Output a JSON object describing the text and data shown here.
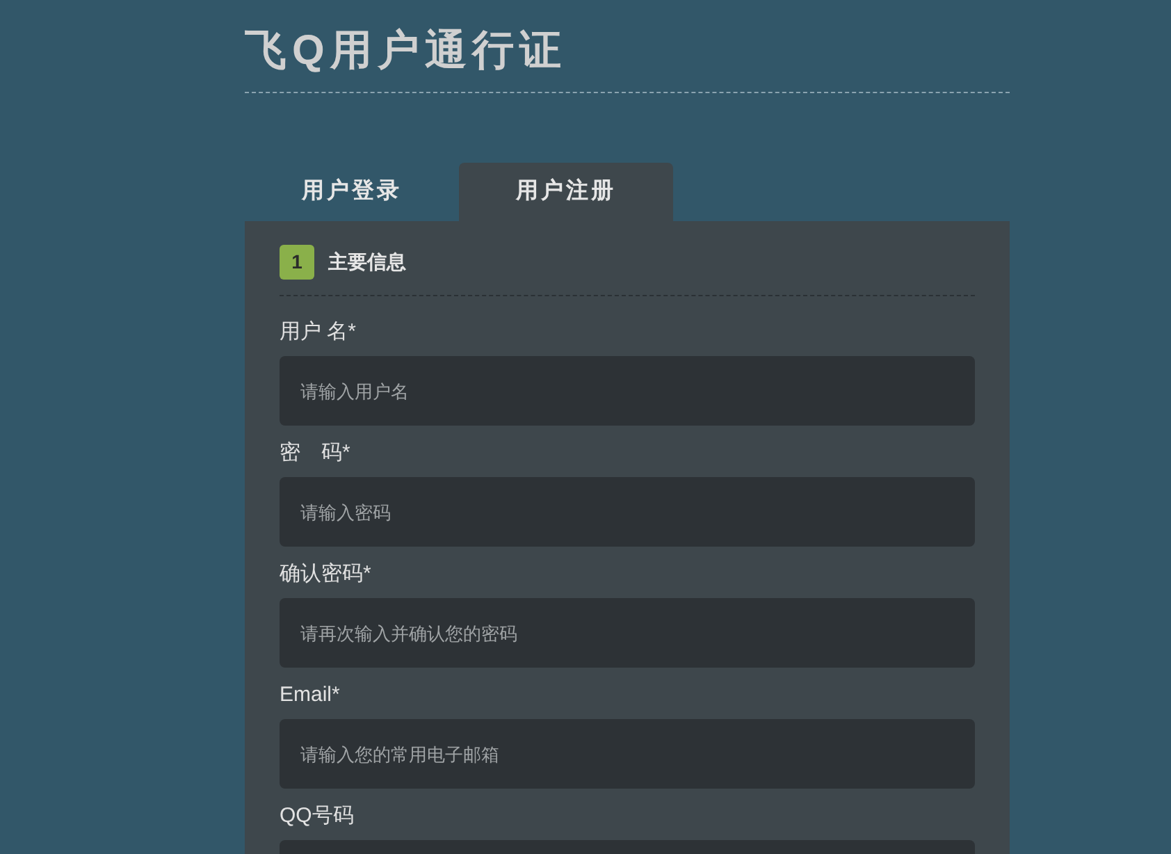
{
  "title": "飞Q用户通行证",
  "tabs": [
    {
      "label": "用户登录",
      "selected": false
    },
    {
      "label": "用户注册",
      "selected": true
    }
  ],
  "section": {
    "number": "1",
    "title": "主要信息"
  },
  "fields": [
    {
      "label": "用户 名*",
      "placeholder": "请输入用户名"
    },
    {
      "label": "密　码*",
      "placeholder": "请输入密码"
    },
    {
      "label": "确认密码*",
      "placeholder": "请再次输入并确认您的密码"
    },
    {
      "label": "Email*",
      "placeholder": "请输入您的常用电子邮箱"
    },
    {
      "label": "QQ号码"
    }
  ]
}
